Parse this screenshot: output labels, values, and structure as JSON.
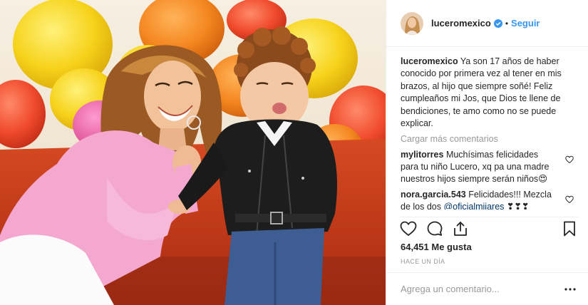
{
  "header": {
    "username": "luceromexico",
    "separator": "•",
    "follow_label": "Seguir"
  },
  "caption": {
    "username": "luceromexico",
    "text": "Ya son 17 años de haber conocido por primera vez al tener en mis brazos, al hijo que siempre soñé! Feliz cumpleaños mi Jos, que Dios te llene de bendiciones, te amo como no se puede explicar."
  },
  "load_more": "Cargar más comentarios",
  "comments": [
    {
      "username": "mylitorres",
      "text": "Muchísimas felicidades para tu niño Lucero, xq pa una madre nuestros hijos siempre serán niños😍",
      "mention": ""
    },
    {
      "username": "nora.garcia.543",
      "text": "Felicidades!!! Mezcla de los dos ",
      "mention": "@oficialmijares",
      "suffix": " ❣❣❣"
    }
  ],
  "likes": {
    "label": "64,451 Me gusta"
  },
  "timestamp": "HACE UN DÍA",
  "add_comment": {
    "placeholder": "Agrega un comentario..."
  },
  "colors": {
    "link_blue": "#3897f0",
    "muted": "#999999",
    "border": "#efefef",
    "text": "#262626"
  },
  "icons": [
    "verified-badge-icon",
    "heart-icon",
    "comment-icon",
    "share-icon",
    "bookmark-icon",
    "more-options-icon"
  ]
}
